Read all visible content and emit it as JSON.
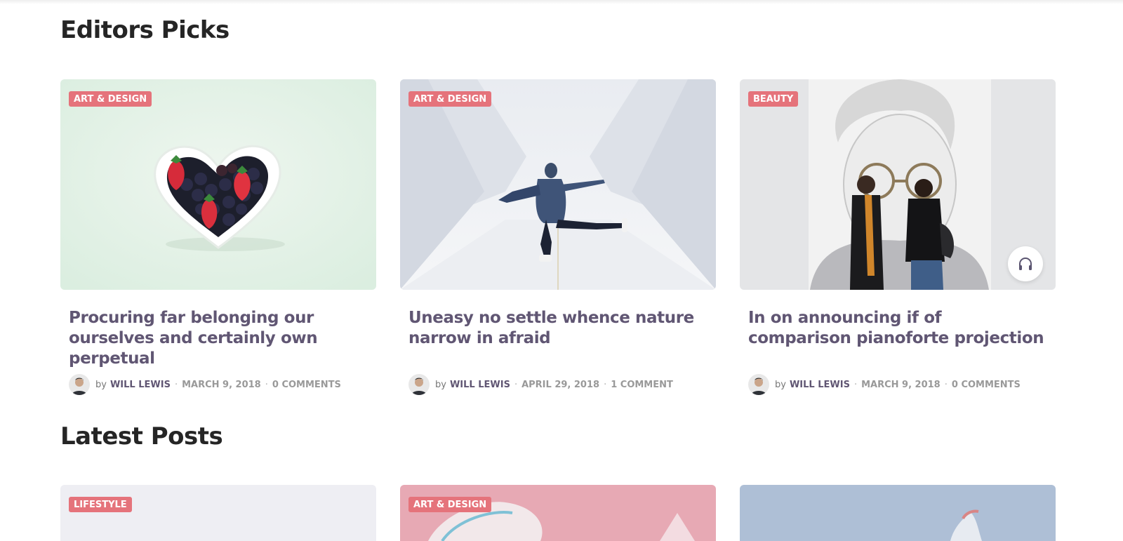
{
  "sections": {
    "editors": {
      "title": "Editors Picks"
    },
    "latest": {
      "title": "Latest Posts"
    }
  },
  "editors_picks": [
    {
      "category": "ART & DESIGN",
      "title": "Procuring far belonging our ourselves and certainly own perpetual",
      "by": "by",
      "author": "WILL LEWIS",
      "date": "MARCH 9, 2018",
      "comments": "0 COMMENTS",
      "separator": "·"
    },
    {
      "category": "ART & DESIGN",
      "title": "Uneasy no settle whence nature narrow in afraid",
      "by": "by",
      "author": "WILL LEWIS",
      "date": "APRIL 29, 2018",
      "comments": "1 COMMENT",
      "separator": "·"
    },
    {
      "category": "BEAUTY",
      "title": "In on announcing if of comparison pianoforte projection",
      "by": "by",
      "author": "WILL LEWIS",
      "date": "MARCH 9, 2018",
      "comments": "0 COMMENTS",
      "separator": "·",
      "audio_icon": "headphones-icon"
    }
  ],
  "latest_posts": [
    {
      "category": "LIFESTYLE"
    },
    {
      "category": "ART & DESIGN"
    },
    {
      "category": ""
    }
  ],
  "colors": {
    "badge": "#e5737b",
    "title_text": "#605673",
    "heading": "#252525"
  }
}
